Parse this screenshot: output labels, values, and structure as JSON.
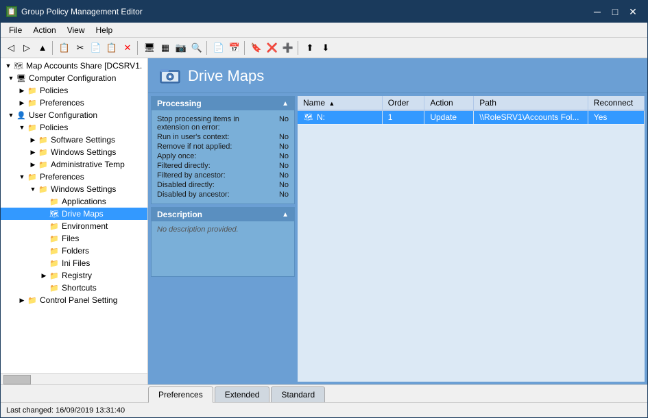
{
  "window": {
    "title": "Group Policy Management Editor",
    "icon": "📋"
  },
  "menu": {
    "items": [
      "File",
      "Action",
      "View",
      "Help"
    ]
  },
  "toolbar": {
    "buttons": [
      "←",
      "→",
      "⬆",
      "|",
      "📋",
      "✂",
      "📋",
      "📋",
      "❌",
      "|",
      "🖥",
      "📺",
      "📷",
      "🔍",
      "|",
      "📄",
      "📅",
      "|",
      "🔖",
      "❌",
      "➕",
      "|",
      "⬆",
      "⬇"
    ]
  },
  "tree": {
    "root_label": "Map Accounts Share [DCSRV1.",
    "nodes": [
      {
        "id": "comp-config",
        "label": "Computer Configuration",
        "level": 0,
        "expanded": true,
        "type": "computer",
        "has_children": true
      },
      {
        "id": "policies-1",
        "label": "Policies",
        "level": 1,
        "expanded": false,
        "type": "folder",
        "has_children": true
      },
      {
        "id": "preferences-1",
        "label": "Preferences",
        "level": 1,
        "expanded": false,
        "type": "folder",
        "has_children": true
      },
      {
        "id": "user-config",
        "label": "User Configuration",
        "level": 0,
        "expanded": true,
        "type": "user",
        "has_children": true
      },
      {
        "id": "policies-2",
        "label": "Policies",
        "level": 1,
        "expanded": true,
        "type": "folder",
        "has_children": true
      },
      {
        "id": "software-settings",
        "label": "Software Settings",
        "level": 2,
        "expanded": false,
        "type": "folder",
        "has_children": true
      },
      {
        "id": "windows-settings",
        "label": "Windows Settings",
        "level": 2,
        "expanded": false,
        "type": "folder",
        "has_children": true
      },
      {
        "id": "admin-temp",
        "label": "Administrative Temp",
        "level": 2,
        "expanded": false,
        "type": "folder",
        "has_children": true
      },
      {
        "id": "preferences-2",
        "label": "Preferences",
        "level": 1,
        "expanded": true,
        "type": "folder",
        "has_children": true
      },
      {
        "id": "windows-settings-2",
        "label": "Windows Settings",
        "level": 2,
        "expanded": true,
        "type": "folder",
        "has_children": true
      },
      {
        "id": "applications",
        "label": "Applications",
        "level": 3,
        "expanded": false,
        "type": "folder",
        "has_children": false
      },
      {
        "id": "drive-maps",
        "label": "Drive Maps",
        "level": 3,
        "expanded": false,
        "type": "drive-map",
        "has_children": false,
        "selected": true
      },
      {
        "id": "environment",
        "label": "Environment",
        "level": 3,
        "expanded": false,
        "type": "folder",
        "has_children": false
      },
      {
        "id": "files",
        "label": "Files",
        "level": 3,
        "expanded": false,
        "type": "folder",
        "has_children": false
      },
      {
        "id": "folders",
        "label": "Folders",
        "level": 3,
        "expanded": false,
        "type": "folder",
        "has_children": false
      },
      {
        "id": "ini-files",
        "label": "Ini Files",
        "level": 3,
        "expanded": false,
        "type": "folder",
        "has_children": false
      },
      {
        "id": "registry",
        "label": "Registry",
        "level": 3,
        "expanded": false,
        "type": "folder",
        "has_children": true
      },
      {
        "id": "shortcuts",
        "label": "Shortcuts",
        "level": 3,
        "expanded": false,
        "type": "folder",
        "has_children": false
      },
      {
        "id": "control-panel",
        "label": "Control Panel Setting",
        "level": 1,
        "expanded": false,
        "type": "folder",
        "has_children": true
      }
    ]
  },
  "content": {
    "title": "Drive Maps",
    "processing": {
      "title": "Processing",
      "rows": [
        {
          "label": "Stop processing items in extension on error:",
          "value": "No"
        },
        {
          "label": "Run in user's context:",
          "value": "No"
        },
        {
          "label": "Remove if not applied:",
          "value": "No"
        },
        {
          "label": "Apply once:",
          "value": "No"
        },
        {
          "label": "Filtered directly:",
          "value": "No"
        },
        {
          "label": "Filtered by ancestor:",
          "value": "No"
        },
        {
          "label": "Disabled directly:",
          "value": "No"
        },
        {
          "label": "Disabled by ancestor:",
          "value": "No"
        }
      ]
    },
    "description": {
      "title": "Description",
      "text": "No description provided."
    },
    "table": {
      "columns": [
        {
          "key": "name",
          "label": "Name",
          "sort": true
        },
        {
          "key": "order",
          "label": "Order"
        },
        {
          "key": "action",
          "label": "Action"
        },
        {
          "key": "path",
          "label": "Path"
        },
        {
          "key": "reconnect",
          "label": "Reconnect"
        }
      ],
      "rows": [
        {
          "name": "N:",
          "order": "1",
          "action": "Update",
          "path": "\\\\RoleSRV1\\Accounts Fol...",
          "reconnect": "Yes",
          "icon": "🗺"
        }
      ]
    }
  },
  "tabs": [
    {
      "label": "Preferences",
      "active": true
    },
    {
      "label": "Extended",
      "active": false
    },
    {
      "label": "Standard",
      "active": false
    }
  ],
  "status": {
    "text": "Last changed: 16/09/2019 13:31:40"
  }
}
